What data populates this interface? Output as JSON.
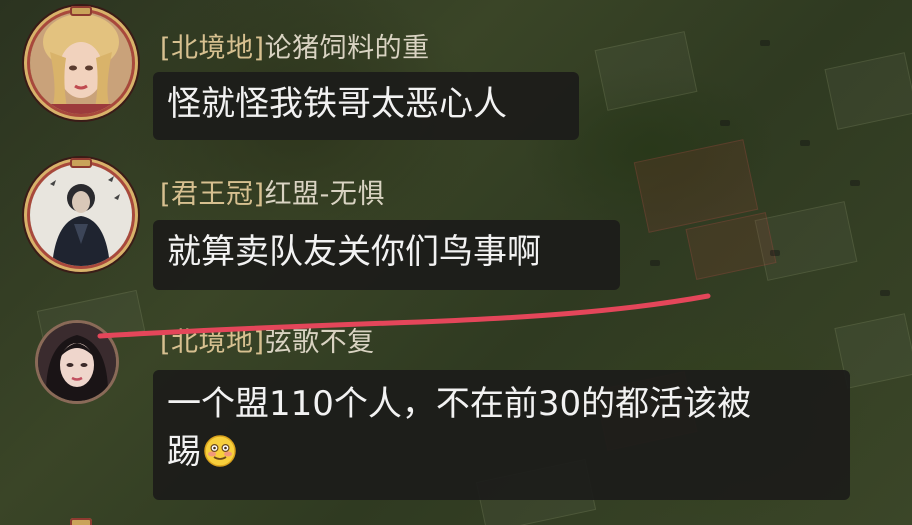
{
  "messages": [
    {
      "tag": "[北境地]",
      "sender": "论猪饲料的重",
      "text": "怪就怪我铁哥太恶心人",
      "avatar_icon": "blonde-woman-avatar-icon"
    },
    {
      "tag": "[君王冠]",
      "sender": "红盟-无惧",
      "text": "就算卖队友关你们鸟事啊",
      "avatar_icon": "dark-robed-figure-avatar-icon"
    },
    {
      "tag": "[北境地]",
      "sender": "弦歌不复",
      "text_line1": "一个盟110个人，不在前30的都活该被",
      "text_line2": "踢",
      "emoji": "blushing-smile-emoji-icon",
      "avatar_icon": "dark-haired-woman-avatar-icon"
    }
  ],
  "colors": {
    "bubble_bg": "#1c1c1a",
    "name_text": "#d9d3c2",
    "alliance_tag": "#d7c090",
    "underline": "#e4465a",
    "avatar_ring": "#a8483c"
  }
}
